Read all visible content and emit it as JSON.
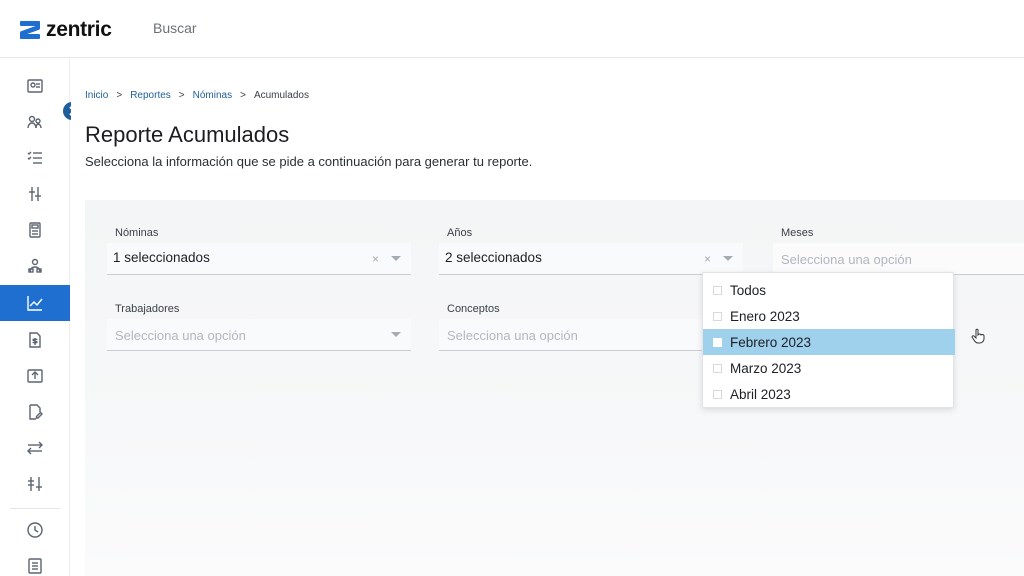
{
  "app": {
    "brand": "zentric"
  },
  "search": {
    "placeholder": "Buscar"
  },
  "breadcrumb": [
    "Inicio",
    "Reportes",
    "Nóminas",
    "Acumulados"
  ],
  "breadcrumb_separator": ">",
  "page": {
    "title": "Reporte Acumulados",
    "subtitle": "Selecciona la información que se pide a continuación para generar tu reporte."
  },
  "fields": {
    "nominas": {
      "label": "Nóminas",
      "value": "1 seleccionados",
      "clear": "×"
    },
    "anios": {
      "label": "Años",
      "value": "2 seleccionados",
      "clear": "×"
    },
    "meses": {
      "label": "Meses",
      "placeholder": "Selecciona una opción"
    },
    "trabajadores": {
      "label": "Trabajadores",
      "placeholder": "Selecciona una opción"
    },
    "conceptos": {
      "label": "Conceptos",
      "placeholder": "Selecciona una opción"
    }
  },
  "meses_options": [
    "Todos",
    "Enero 2023",
    "Febrero 2023",
    "Marzo 2023",
    "Abril 2023"
  ],
  "meses_highlighted": "Febrero 2023",
  "sidebar_icons": [
    "id-card-icon",
    "users-icon",
    "checklist-icon",
    "sliders-icon",
    "calculator-icon",
    "people-group-icon",
    "chart-icon",
    "document-money-icon",
    "upload-icon",
    "document-edit-icon",
    "transfer-icon",
    "settings-sliders-icon",
    "clock-icon",
    "list-icon"
  ],
  "colors": {
    "accent": "#1f6fd1",
    "highlight": "#9fd0ec",
    "link": "#1f5f99"
  }
}
